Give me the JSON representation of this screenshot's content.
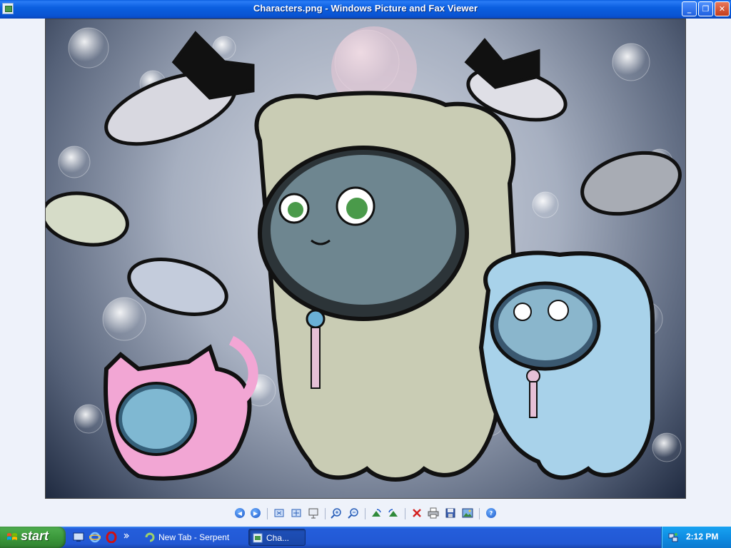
{
  "window": {
    "title": "Characters.png - Windows Picture and Fax Viewer",
    "minimize_glyph": "_",
    "maximize_glyph": "❐",
    "close_glyph": "✕"
  },
  "toolbar": {
    "icons": [
      "previous-image-icon",
      "next-image-icon",
      "best-fit-icon",
      "actual-size-icon",
      "slide-show-icon",
      "zoom-in-icon",
      "zoom-out-icon",
      "rotate-clockwise-icon",
      "rotate-counterclockwise-icon",
      "delete-icon",
      "print-icon",
      "save-icon",
      "edit-icon",
      "help-icon"
    ],
    "help_glyph": "?"
  },
  "taskbar": {
    "start_label": "start",
    "tasks": [
      {
        "label": "New Tab - Serpent",
        "icon": "serpent-browser-icon"
      },
      {
        "label": "Cha...",
        "icon": "picture-viewer-icon"
      }
    ],
    "clock": "2:12 PM"
  },
  "colors": {
    "titlebar": "#0b5fe0",
    "taskbar": "#2258d4",
    "start_green": "#3c9a3c",
    "tray": "#0e8de3",
    "viewer_background": "#eef2fa"
  }
}
